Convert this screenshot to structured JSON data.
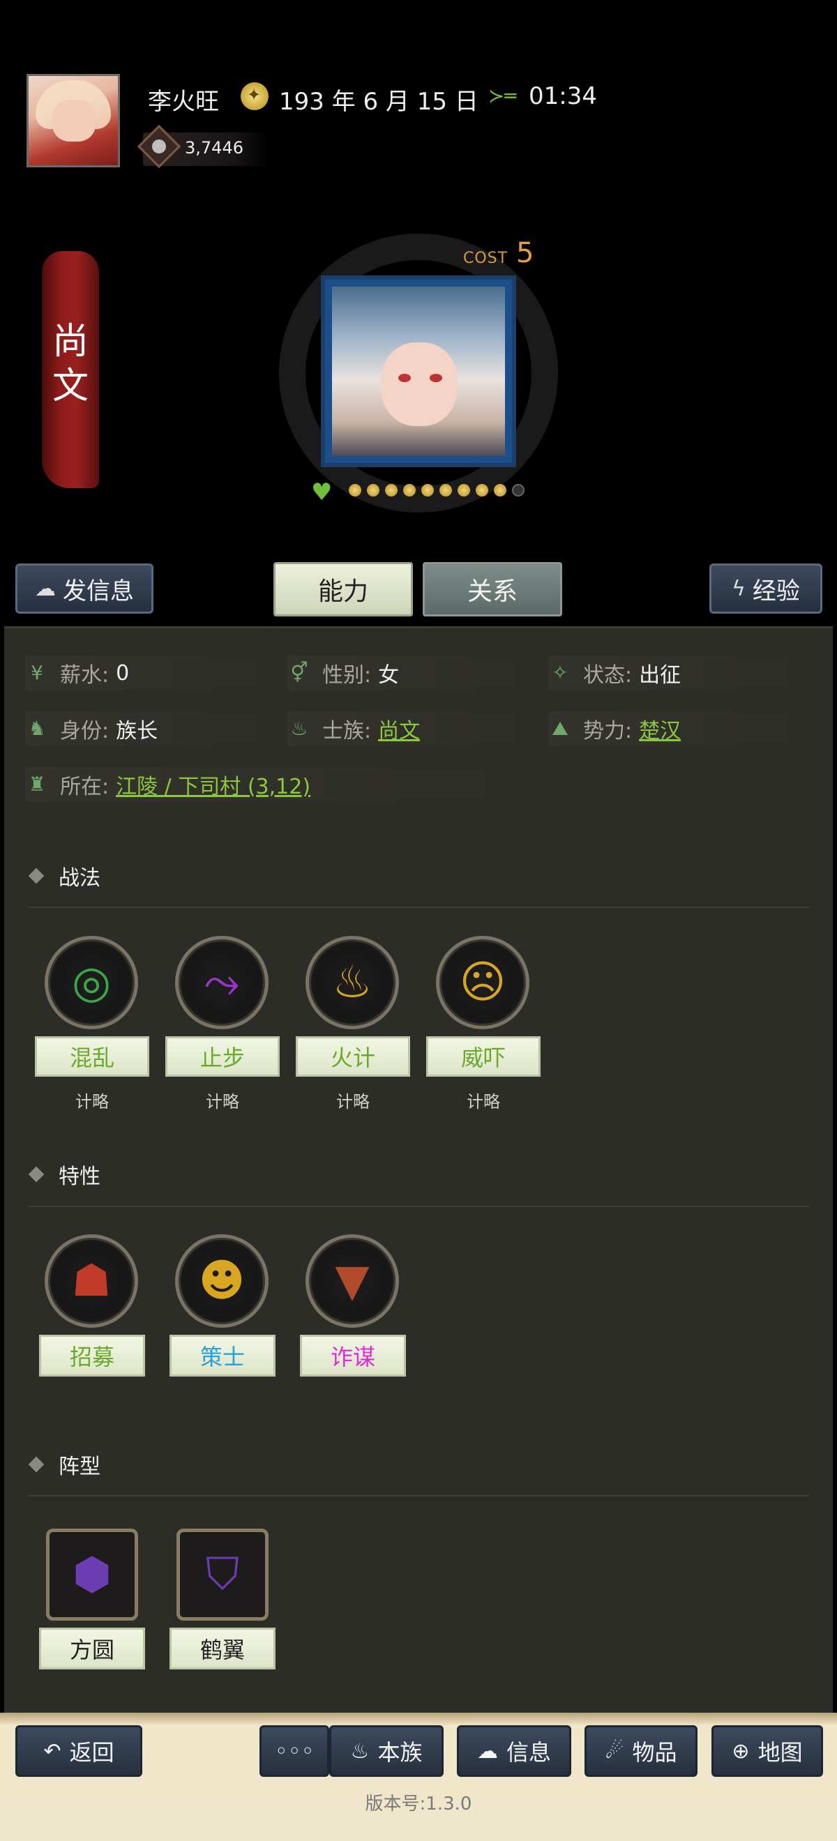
{
  "header": {
    "player_name": "李火旺",
    "date": "193 年 6 月 15 日",
    "time": "01:34",
    "money": "3,7446"
  },
  "character": {
    "clan_name": "尚\n文",
    "cost_label": "COST",
    "cost_value": "5",
    "pips_filled": 9,
    "pips_total": 10
  },
  "actions": {
    "send_message": "发信息",
    "tab_ability": "能力",
    "tab_relation": "关系",
    "experience": "经验"
  },
  "info": {
    "salary_label": "薪水:",
    "salary_value": "0",
    "gender_label": "性别:",
    "gender_value": "女",
    "status_label": "状态:",
    "status_value": "出征",
    "identity_label": "身份:",
    "identity_value": "族长",
    "clan_label": "士族:",
    "clan_value": "尚文",
    "force_label": "势力:",
    "force_value": "楚汉",
    "location_label": "所在:",
    "location_value": "江陵 / 下司村 (3,12)"
  },
  "tactics": {
    "title": "战法",
    "items": [
      {
        "name": "混乱",
        "type": "计略",
        "color": "#6aaa2a"
      },
      {
        "name": "止步",
        "type": "计略",
        "color": "#6aaa2a"
      },
      {
        "name": "火计",
        "type": "计略",
        "color": "#6aaa2a"
      },
      {
        "name": "威吓",
        "type": "计略",
        "color": "#6aaa2a"
      }
    ]
  },
  "traits": {
    "title": "特性",
    "items": [
      {
        "name": "招募",
        "color": "#6aaa2a"
      },
      {
        "name": "策士",
        "color": "#2aa0d8"
      },
      {
        "name": "诈谋",
        "color": "#e02ad8"
      }
    ]
  },
  "formations": {
    "title": "阵型",
    "items": [
      {
        "name": "方圆"
      },
      {
        "name": "鹤翼"
      }
    ]
  },
  "bottom": {
    "back": "返回",
    "more": "◦◦◦",
    "clan": "本族",
    "message": "信息",
    "items": "物品",
    "map": "地图",
    "version": "版本号:1.3.0"
  }
}
